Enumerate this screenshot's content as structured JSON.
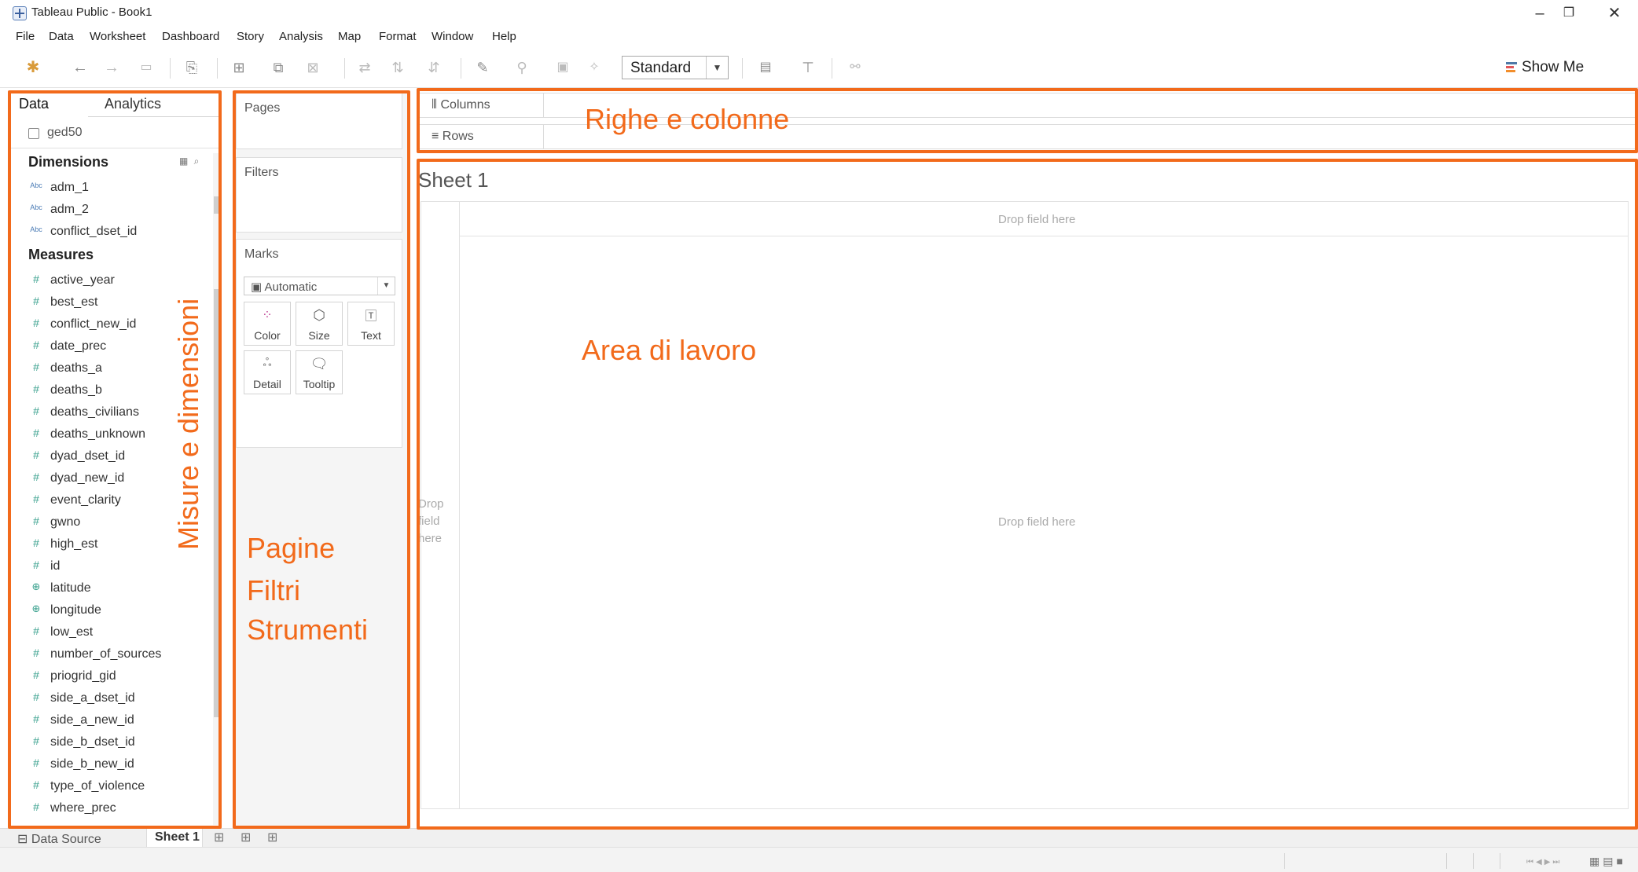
{
  "window": {
    "title": "Tableau Public - Book1",
    "minimize_glyph": "–",
    "restore_glyph": "❐",
    "close_glyph": "✕"
  },
  "menu": [
    "File",
    "Data",
    "Worksheet",
    "Dashboard",
    "Story",
    "Analysis",
    "Map",
    "Format",
    "Window",
    "Help"
  ],
  "toolbar": {
    "fit_select": "Standard",
    "show_me": "Show Me",
    "icons": [
      "tableau-logo-icon",
      "undo-icon",
      "redo-icon",
      "save-icon",
      "new-datasource-icon",
      "new-worksheet-icon",
      "duplicate-icon",
      "clear-icon",
      "swap-icon",
      "sort-ascending-icon",
      "sort-descending-icon",
      "highlight-icon",
      "group-icon",
      "label-icon",
      "fix-axes-icon",
      "show-cards-icon",
      "presentation-icon",
      "share-icon"
    ]
  },
  "data_pane": {
    "tabs": [
      "Data",
      "Analytics"
    ],
    "datasource": "ged50",
    "dimensions_title": "Dimensions",
    "measures_title": "Measures",
    "dimensions": [
      {
        "type": "Abc",
        "name": "adm_1"
      },
      {
        "type": "Abc",
        "name": "adm_2"
      },
      {
        "type": "Abc",
        "name": "conflict_dset_id"
      }
    ],
    "measures": [
      {
        "type": "#",
        "name": "active_year"
      },
      {
        "type": "#",
        "name": "best_est"
      },
      {
        "type": "#",
        "name": "conflict_new_id"
      },
      {
        "type": "#",
        "name": "date_prec"
      },
      {
        "type": "#",
        "name": "deaths_a"
      },
      {
        "type": "#",
        "name": "deaths_b"
      },
      {
        "type": "#",
        "name": "deaths_civilians"
      },
      {
        "type": "#",
        "name": "deaths_unknown"
      },
      {
        "type": "#",
        "name": "dyad_dset_id"
      },
      {
        "type": "#",
        "name": "dyad_new_id"
      },
      {
        "type": "#",
        "name": "event_clarity"
      },
      {
        "type": "#",
        "name": "gwno"
      },
      {
        "type": "#",
        "name": "high_est"
      },
      {
        "type": "#",
        "name": "id"
      },
      {
        "type": "geo",
        "name": "latitude"
      },
      {
        "type": "geo",
        "name": "longitude"
      },
      {
        "type": "#",
        "name": "low_est"
      },
      {
        "type": "#",
        "name": "number_of_sources"
      },
      {
        "type": "#",
        "name": "priogrid_gid"
      },
      {
        "type": "#",
        "name": "side_a_dset_id"
      },
      {
        "type": "#",
        "name": "side_a_new_id"
      },
      {
        "type": "#",
        "name": "side_b_dset_id"
      },
      {
        "type": "#",
        "name": "side_b_new_id"
      },
      {
        "type": "#",
        "name": "type_of_violence"
      },
      {
        "type": "#",
        "name": "where_prec"
      }
    ]
  },
  "cards": {
    "pages": "Pages",
    "filters": "Filters",
    "marks": "Marks",
    "marks_type": "Automatic",
    "mark_buttons": [
      {
        "label": "Color",
        "icon": "color-icon"
      },
      {
        "label": "Size",
        "icon": "size-icon"
      },
      {
        "label": "Text",
        "icon": "text-icon"
      },
      {
        "label": "Detail",
        "icon": "detail-icon"
      },
      {
        "label": "Tooltip",
        "icon": "tooltip-icon"
      }
    ]
  },
  "shelves": {
    "columns": "Columns",
    "rows": "Rows"
  },
  "worksheet": {
    "title": "Sheet 1",
    "drop_columns": "Drop field here",
    "drop_center": "Drop field here",
    "drop_rows": "Drop field here"
  },
  "bottom_tabs": {
    "data_source": "Data Source",
    "sheet": "Sheet 1"
  },
  "annotations": {
    "color": "#f26a1b",
    "rows_columns": "Righe e colonne",
    "measures_dimensions": "Misure e dimensioni",
    "workspace": "Area di lavoro",
    "pages": "Pagine",
    "filters": "Filtri",
    "tools": "Strumenti"
  }
}
